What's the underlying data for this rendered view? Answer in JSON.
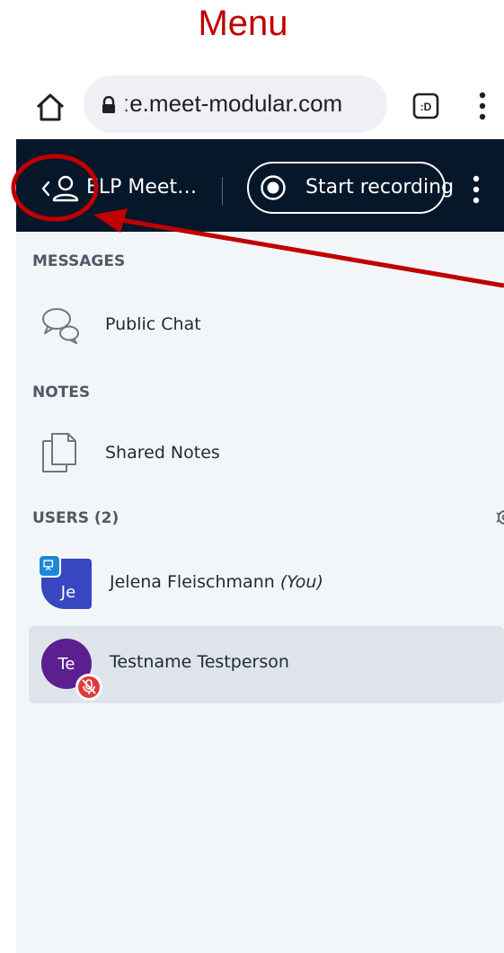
{
  "caption": "Menu",
  "browser": {
    "url": "ːe.meet-modular.com",
    "tab_count": ":D"
  },
  "navbar": {
    "meeting_title": "ELP Meet…",
    "record_label": "Start recording"
  },
  "sections": {
    "messages": "MESSAGES",
    "notes": "NOTES",
    "users": "USERS (2)"
  },
  "items": {
    "public_chat": "Public Chat",
    "shared_notes": "Shared Notes"
  },
  "users": [
    {
      "initials": "Je",
      "name": "Jelena Fleischmann",
      "suffix": "(You)",
      "color": "#3647c0"
    },
    {
      "initials": "Te",
      "name": "Testname Testperson",
      "color": "#5b1f8f"
    }
  ],
  "colors": {
    "navbar": "#06172a",
    "panel": "#f3f6f9",
    "annotation": "#c00000",
    "mute_badge": "#e03a3e",
    "presenter_badge": "#1b8ad6"
  }
}
